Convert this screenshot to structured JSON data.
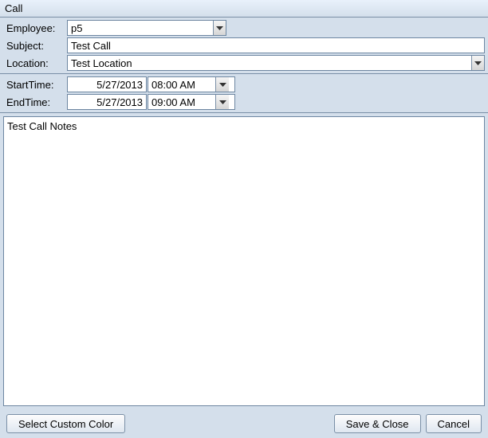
{
  "title": "Call",
  "labels": {
    "employee": "Employee:",
    "subject": "Subject:",
    "location": "Location:",
    "startTime": "StartTime:",
    "endTime": "EndTime:"
  },
  "fields": {
    "employee": "p5",
    "subject": "Test Call",
    "location": "Test Location",
    "startDate": "5/27/2013",
    "startTime": "08:00 AM",
    "endDate": "5/27/2013",
    "endTime": "09:00 AM",
    "notes": "Test Call Notes"
  },
  "buttons": {
    "selectColor": "Select Custom Color",
    "saveClose": "Save & Close",
    "cancel": "Cancel"
  }
}
